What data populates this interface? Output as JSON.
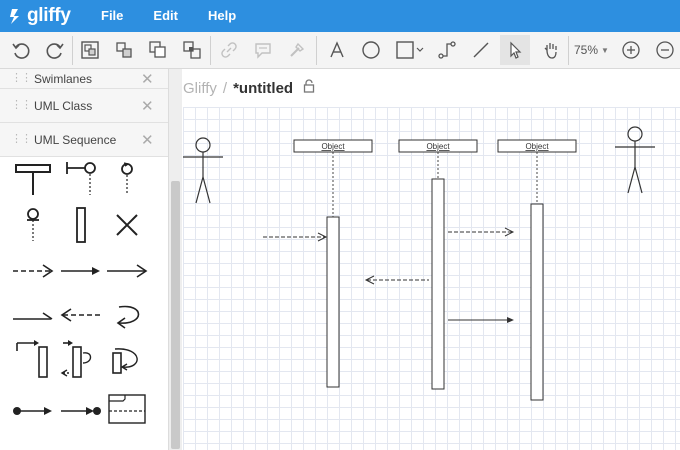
{
  "app": {
    "logo_text": "gliffy",
    "menu": [
      "File",
      "Edit",
      "Help"
    ]
  },
  "toolbar": {
    "zoom_label": "75%",
    "icons": [
      "undo-icon",
      "redo-icon",
      "group-icon",
      "ungroup-icon",
      "bring-front-icon",
      "send-back-icon",
      "link-icon",
      "comment-icon",
      "format-painter-icon",
      "text-tool-icon",
      "ellipse-tool-icon",
      "rectangle-tool-icon",
      "connector-tool-icon",
      "line-tool-icon",
      "pointer-tool-icon",
      "pan-tool-icon",
      "zoom-in-icon",
      "zoom-out-icon"
    ]
  },
  "sidebar": {
    "libraries": [
      "Swimlanes",
      "UML Class",
      "UML Sequence"
    ]
  },
  "document": {
    "breadcrumb": "Gliffy",
    "separator": "/",
    "title": "*untitled"
  },
  "diagram": {
    "objects": [
      "Object",
      "Object",
      "Object"
    ]
  },
  "colors": {
    "menubar": "#2d8fe0",
    "grid": "#e3e7f0",
    "stroke": "#333333"
  }
}
